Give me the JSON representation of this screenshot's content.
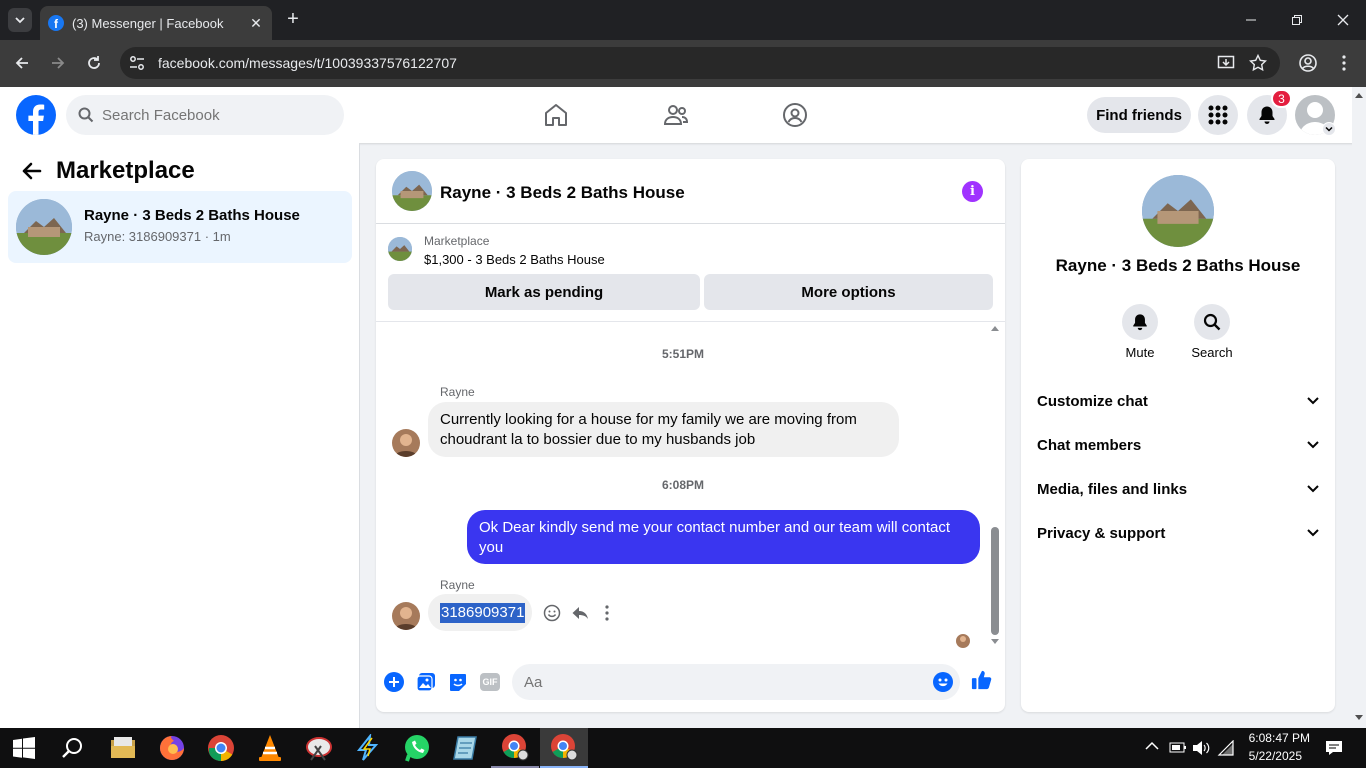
{
  "browser": {
    "tab_title": "(3) Messenger | Facebook",
    "url": "facebook.com/messages/t/100393375761227​07"
  },
  "header": {
    "search_placeholder": "Search Facebook",
    "find_friends_label": "Find friends",
    "notification_count": "3"
  },
  "sidebar": {
    "title": "Marketplace",
    "conversations": [
      {
        "name": "Rayne · 3 Beds 2 Baths House",
        "preview": "Rayne: 3186909371 · 1m"
      }
    ]
  },
  "chat": {
    "title": "Rayne · 3 Beds 2 Baths House",
    "marketplace_label": "Marketplace",
    "listing": "$1,300 - 3 Beds 2 Baths House",
    "mark_pending_label": "Mark as pending",
    "more_options_label": "More options",
    "messages": [
      {
        "type": "timestamp",
        "text": "5:51PM"
      },
      {
        "type": "incoming",
        "sender": "Rayne",
        "text": "Currently looking for a house for my family we are moving from choudrant la to bossier due to my husbands job"
      },
      {
        "type": "timestamp",
        "text": "6:08PM"
      },
      {
        "type": "outgoing",
        "text": "Ok Dear kindly send me your contact number and our team will contact you"
      },
      {
        "type": "incoming",
        "sender": "Rayne",
        "text": "3186909371"
      }
    ],
    "composer_placeholder": "Aa",
    "gif_label": "GIF"
  },
  "details": {
    "name": "Rayne · 3 Beds 2 Baths House",
    "mute_label": "Mute",
    "search_label": "Search",
    "sections": [
      "Customize chat",
      "Chat members",
      "Media, files and links",
      "Privacy & support"
    ]
  },
  "taskbar": {
    "time": "6:08:47 PM",
    "date": "5/22/2025"
  },
  "colors": {
    "fb_blue": "#0866ff",
    "outgoing_bubble": "#3a36f0",
    "info_purple": "#a033ff",
    "badge_red": "#e41e3f"
  }
}
